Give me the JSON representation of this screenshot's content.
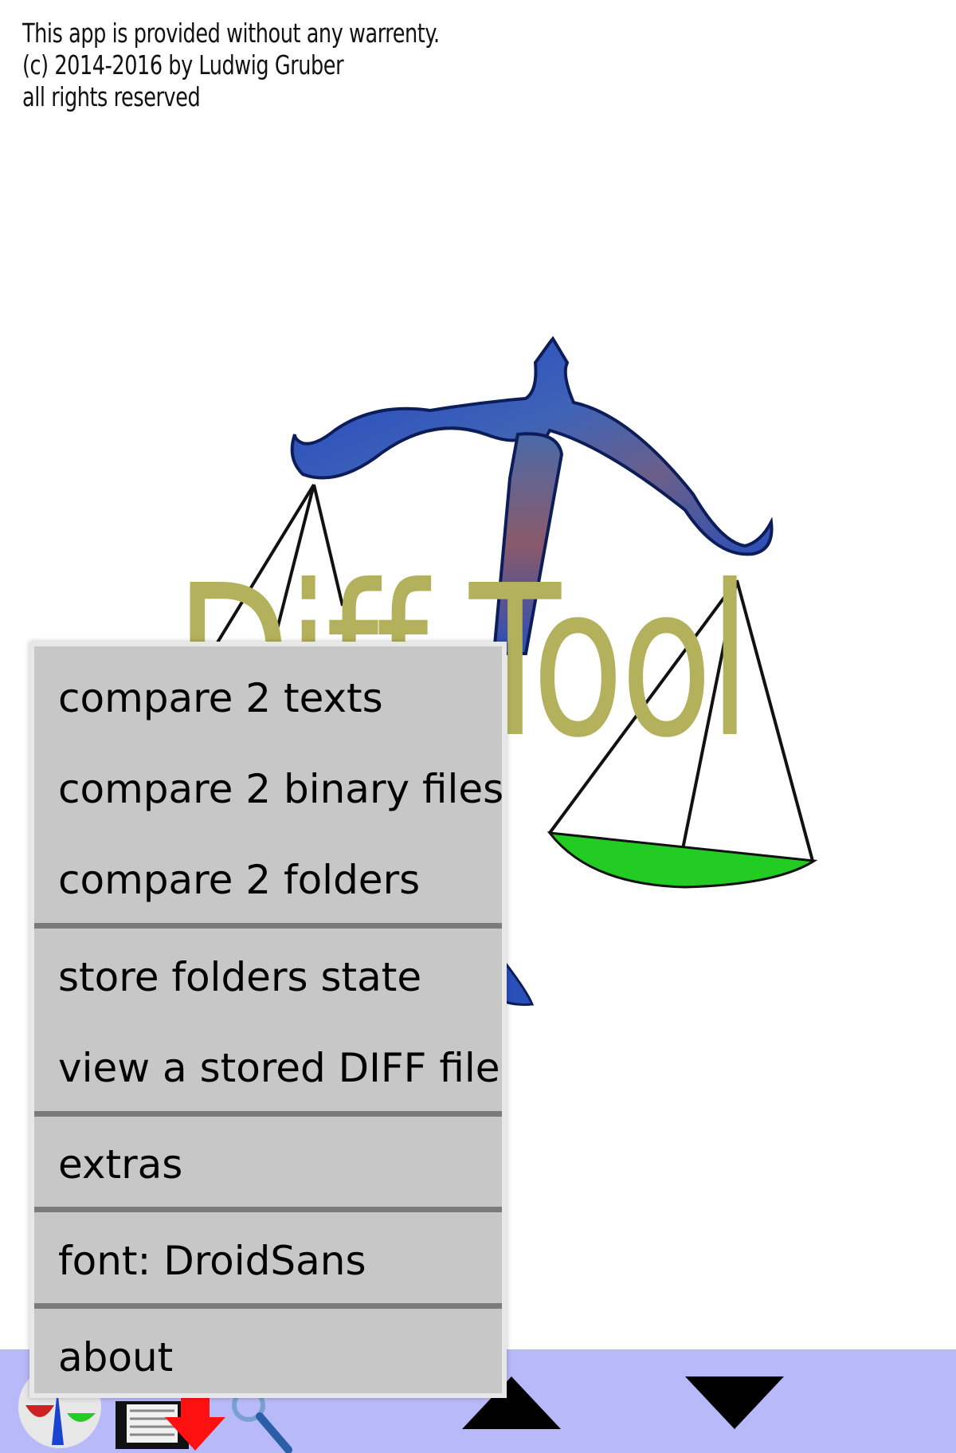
{
  "disclaimer": {
    "line1": "This app is provided without any warrenty.",
    "line2": "(c) 2014-2016 by Ludwig Gruber",
    "line3": "all rights reserved"
  },
  "app_title": "Diff Tool",
  "menu": {
    "items": [
      {
        "label": "compare 2 texts"
      },
      {
        "label": "compare 2 binary files"
      },
      {
        "label": "compare 2 folders"
      },
      {
        "label": "store folders state"
      },
      {
        "label": "view a stored DIFF file"
      },
      {
        "label": "extras"
      },
      {
        "label": "font: DroidSans"
      },
      {
        "label": "about"
      }
    ]
  },
  "bottom_bar": {
    "icons": [
      "app-logo-icon",
      "save-floppy-icon",
      "search-magnifier-icon",
      "arrow-up-icon",
      "arrow-down-icon"
    ]
  },
  "colors": {
    "title": "#b3b15c",
    "bottom_bar": "#b8b9f9",
    "menu_bg": "#c7c7c7",
    "menu_separator": "#7b7b7b",
    "scale_pan": "#22cc22",
    "scale_beam": "#2a4fb8"
  }
}
